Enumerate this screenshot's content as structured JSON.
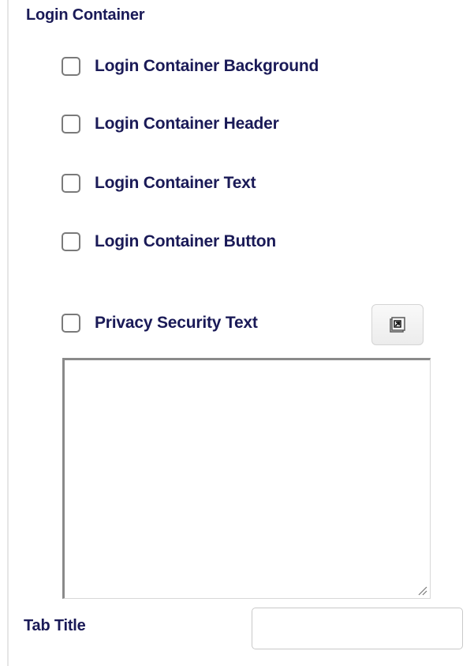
{
  "section": {
    "title": "Login Container"
  },
  "checkboxes": [
    {
      "label": "Login Container Background",
      "checked": false
    },
    {
      "label": "Login Container Header",
      "checked": false
    },
    {
      "label": "Login Container Text",
      "checked": false
    },
    {
      "label": "Login Container Button",
      "checked": false
    },
    {
      "label": "Privacy Security Text",
      "checked": false
    }
  ],
  "privacy_text": {
    "value": "",
    "expand_icon": "expand-icon"
  },
  "tab_title": {
    "label": "Tab Title",
    "value": ""
  }
}
